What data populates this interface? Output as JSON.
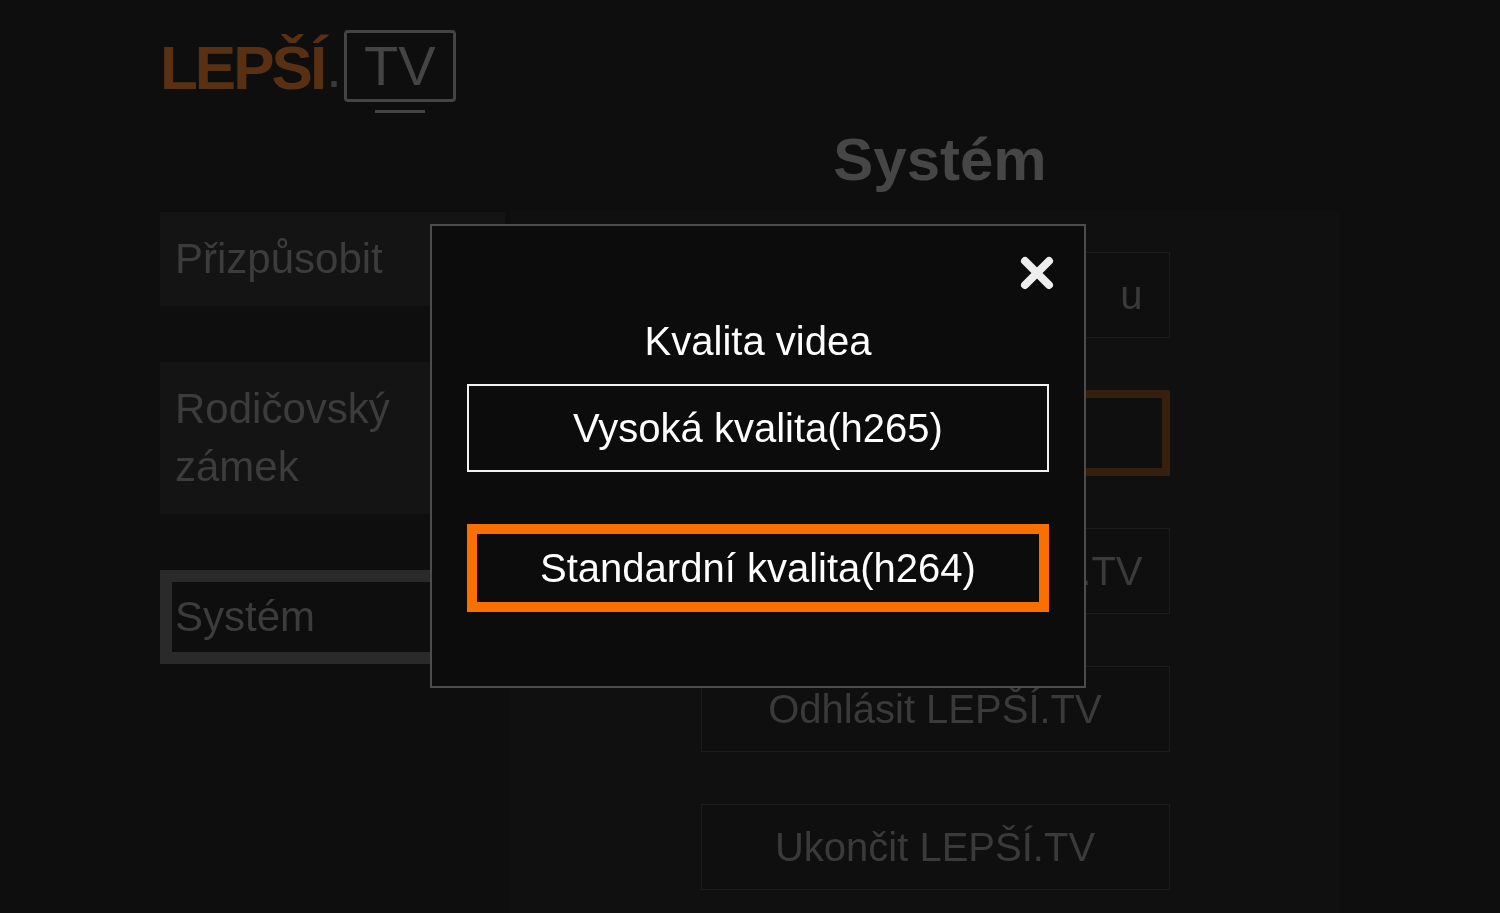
{
  "logo": {
    "brand": "LEPŠÍ",
    "dot": ".",
    "tv": "TV"
  },
  "page_title": "Systém",
  "sidebar": {
    "items": [
      {
        "label": "Přizpůsobit",
        "selected": false
      },
      {
        "label": "Rodičovský zámek",
        "selected": false
      },
      {
        "label": "Systém",
        "selected": true
      }
    ]
  },
  "settings_buttons": [
    {
      "label": "u",
      "selected": false,
      "clipped": true
    },
    {
      "selected": true,
      "clipped": true
    },
    {
      "label": ".TV",
      "selected": false,
      "clipped": true
    },
    {
      "label": "Odhlásit LEPŠÍ.TV",
      "selected": false,
      "clipped": false
    },
    {
      "label": "Ukončit LEPŠÍ.TV",
      "selected": false,
      "clipped": false
    }
  ],
  "dialog": {
    "title": "Kvalita videa",
    "options": [
      {
        "label": "Vysoká kvalita(h265)",
        "selected": false
      },
      {
        "label": "Standardní kvalita(h264)",
        "selected": true
      }
    ]
  }
}
